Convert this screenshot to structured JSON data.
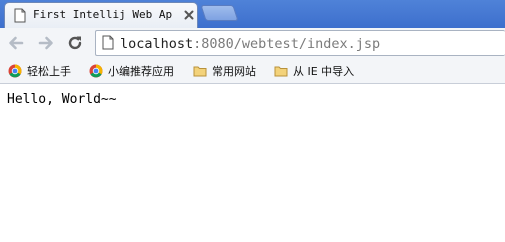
{
  "browser": {
    "tab": {
      "title": "First Intellij Web Appl"
    },
    "address_bar": {
      "host": "localhost",
      "rest": ":8080/webtest/index.jsp"
    },
    "bookmarks": [
      {
        "label": "轻松上手",
        "icon": "chrome-icon"
      },
      {
        "label": "小编推荐应用",
        "icon": "chrome-icon"
      },
      {
        "label": "常用网站",
        "icon": "folder-icon"
      },
      {
        "label": "从 IE 中导入",
        "icon": "folder-icon"
      }
    ]
  },
  "page": {
    "body_text": "Hello, World~~"
  },
  "colors": {
    "tabstrip": "#4f82d8",
    "toolbar": "#f3f5f8",
    "url_host": "#222222",
    "url_rest": "#7b7b7b"
  }
}
